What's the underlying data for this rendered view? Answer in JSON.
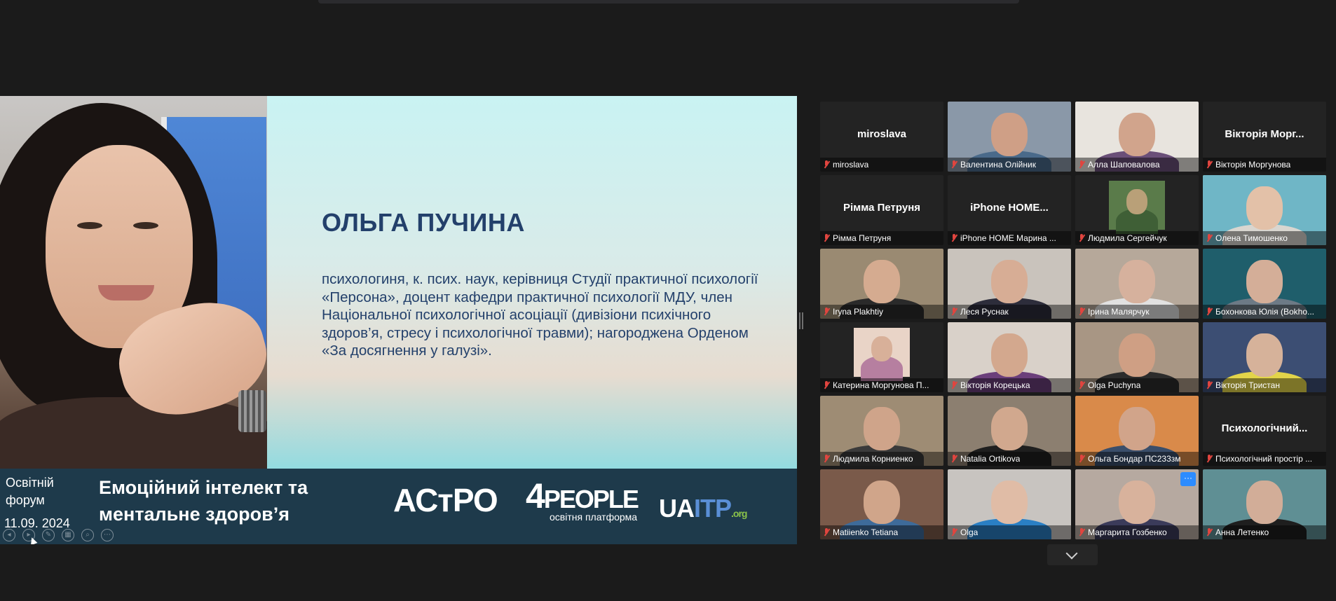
{
  "slide": {
    "speaker_name": "ОЛЬГА ПУЧИНА",
    "speaker_bio": "психологиня, к. псих. наук, керівниця Студії практичної психології «Персона», доцент кафедри практичної психології МДУ, член Національної психологічної асоціації (дивізіони психічного здоров’я, стресу і психологічної травми); нагороджена Орденом «За досягнення у галузі».",
    "forum_label": "Освітній форум",
    "forum_date": "11.09. 2024",
    "forum_title": "Емоційний інтелект та ментальне здоров’я",
    "logo_astro": "АСтРО",
    "logo_4people": "4PEOPLE",
    "logo_4people_digit": "4",
    "logo_4people_word": "PEOPLE",
    "logo_4people_sub": "освітня платформа",
    "logo_uaitp_a": "UA",
    "logo_uaitp_b": "ITP",
    "logo_uaitp_org": ".org"
  },
  "participants": [
    {
      "name": "miroslava",
      "display": "miroslava",
      "video": false
    },
    {
      "name": "Валентина Олійник",
      "video": true,
      "bg": "#8a98a8",
      "skin": "#cf9f86",
      "cloth": "#4a6a8a"
    },
    {
      "name": "Алла Шаповалова",
      "video": true,
      "bg": "#e8e4de",
      "skin": "#d1a48c",
      "cloth": "#6a4f78"
    },
    {
      "name": "Вікторія Моргунова",
      "display": "Вікторія Морг...",
      "video": false
    },
    {
      "name": "Рімма Петруня",
      "display": "Рімма Петруня",
      "video": false
    },
    {
      "name": "iPhone HOME Марина ...",
      "display": "iPhone HOME...",
      "video": false
    },
    {
      "name": "Людмила Сергейчук",
      "video": true,
      "small": true,
      "bg": "#5a7b4a",
      "skin": "#b9a078",
      "cloth": "#3f5f36"
    },
    {
      "name": "Олена Тимошенко",
      "video": true,
      "active": true,
      "bg": "#6fb6c6",
      "skin": "#e3c1a8",
      "cloth": "#d9d6d0"
    },
    {
      "name": "Iryna Plakhtiy",
      "video": true,
      "bg": "#9a8a72",
      "skin": "#d5ab90",
      "cloth": "#2a2a2a"
    },
    {
      "name": "Леся Руснак",
      "video": true,
      "bg": "#c9c3bc",
      "skin": "#d7ad95",
      "cloth": "#2d2d3b"
    },
    {
      "name": "Ірина Малярчук",
      "video": true,
      "bg": "#b6a89a",
      "skin": "#d6b19d",
      "cloth": "#e1e1e1"
    },
    {
      "name": "Бохонкова Юлія (Bokho...",
      "video": true,
      "bg": "#1f5e6b",
      "skin": "#d4ae98",
      "cloth": "#6d7a86"
    },
    {
      "name": "Катерина Моргунова П...",
      "video": true,
      "small": true,
      "bg": "#e9d4c7",
      "skin": "#d8b099",
      "cloth": "#b67fa0"
    },
    {
      "name": "Вікторія Корецька",
      "video": true,
      "bg": "#d9d1c9",
      "skin": "#d3a88e",
      "cloth": "#6b3f7b"
    },
    {
      "name": "Olga Puchyna",
      "video": true,
      "bg": "#a89684",
      "skin": "#cf9f84",
      "cloth": "#2c2c2c"
    },
    {
      "name": "Вікторія Тристан",
      "video": true,
      "bg": "#3c4e73",
      "skin": "#d6b29a",
      "cloth": "#e2d44a"
    },
    {
      "name": "Людмила Корниенко",
      "video": true,
      "bg": "#9e8c74",
      "skin": "#cfa48a",
      "cloth": "#3a3a3a"
    },
    {
      "name": "Natalia Ortikova",
      "video": true,
      "bg": "#8c7f70",
      "skin": "#d1a88e",
      "cloth": "#1f1f1f"
    },
    {
      "name": "Ольга Бондар ПС233зм",
      "video": true,
      "bg": "#d98a4a",
      "skin": "#d1a48a",
      "cloth": "#3a4e6a"
    },
    {
      "name": "Психологічний простір ...",
      "display": "Психологічний...",
      "video": false
    },
    {
      "name": "Matiienko Tetiana",
      "video": true,
      "bg": "#7a5a4a",
      "skin": "#d0a58a",
      "cloth": "#3e6b9a"
    },
    {
      "name": "Olga",
      "video": true,
      "bg": "#c8c4c0",
      "skin": "#e0bca6",
      "cloth": "#2a7fc4"
    },
    {
      "name": "Маргарита Гозбенко",
      "video": true,
      "more": true,
      "bg": "#b6a9a0",
      "skin": "#d8b29c",
      "cloth": "#3b3b5a"
    },
    {
      "name": "Анна Летенко",
      "video": true,
      "bg": "#5f8f94",
      "skin": "#d2ad98",
      "cloth": "#1e1e1e"
    }
  ],
  "more_label": "···"
}
